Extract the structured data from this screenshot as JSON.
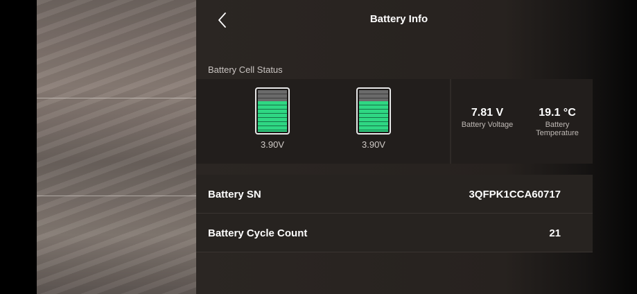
{
  "header": {
    "title": "Battery Info",
    "back_icon": "chevron-left-icon"
  },
  "cell_status": {
    "section_label": "Battery Cell Status",
    "cells": [
      {
        "voltage": "3.90V",
        "level": 0.73,
        "color": "#2fd783"
      },
      {
        "voltage": "3.90V",
        "level": 0.73,
        "color": "#2fd783"
      }
    ],
    "battery_voltage": {
      "value": "7.81 V",
      "label": "Battery Voltage"
    },
    "battery_temperature": {
      "value": "19.1 °C",
      "label": "Battery Temperature"
    }
  },
  "details": {
    "serial_label": "Battery SN",
    "serial_value": "3QFPK1CCA60717",
    "cycle_label": "Battery Cycle Count",
    "cycle_value": "21"
  }
}
